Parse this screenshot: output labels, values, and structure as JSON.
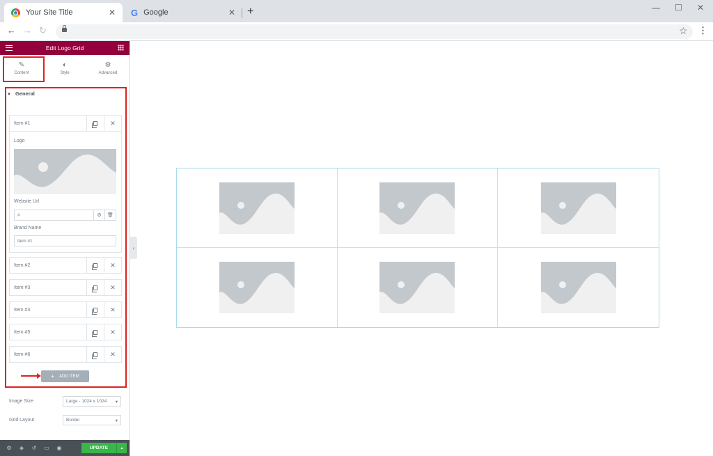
{
  "browser": {
    "tabs": [
      {
        "label": "Your Site Title",
        "active": true
      },
      {
        "label": "Google",
        "active": false
      }
    ],
    "new_tab_symbol": "+",
    "window_controls": [
      "—",
      "☐",
      "✕"
    ],
    "nav_icons": [
      "back-arrow-icon",
      "forward-arrow-icon",
      "reload-icon",
      "lock-icon",
      "star-icon",
      "menu-kebab-icon"
    ]
  },
  "editor": {
    "header_title": "Edit Logo Grid",
    "tabs": [
      {
        "label": "Content",
        "icon": "pencil-icon"
      },
      {
        "label": "Style",
        "icon": "contrast-icon"
      },
      {
        "label": "Advanced",
        "icon": "gear-icon"
      }
    ],
    "section": {
      "title": "General"
    },
    "items": [
      {
        "label": "Item #1",
        "expanded": true
      },
      {
        "label": "Item #2"
      },
      {
        "label": "Item #3"
      },
      {
        "label": "Item #4"
      },
      {
        "label": "Item #5"
      },
      {
        "label": "Item #6"
      }
    ],
    "item_fields": {
      "logo_label": "Logo",
      "website_url_label": "Website Url",
      "website_url_value": "#",
      "brand_name_label": "Brand Name",
      "brand_name_value": "Item #1"
    },
    "add_item_label": "ADD ITEM",
    "controls": [
      {
        "label": "Image Size",
        "value": "Large - 1024 x 1024"
      },
      {
        "label": "Grid Layout",
        "value": "Border"
      }
    ],
    "update_label": "UPDATE"
  },
  "colors": {
    "header": "#93003c",
    "highlight": "#e02020",
    "update": "#39b54a",
    "footer": "#495157",
    "grid_border": "#a8dbe8"
  },
  "preview": {
    "logo_grid": {
      "columns": 3,
      "rows": 2,
      "cells": 6
    }
  }
}
